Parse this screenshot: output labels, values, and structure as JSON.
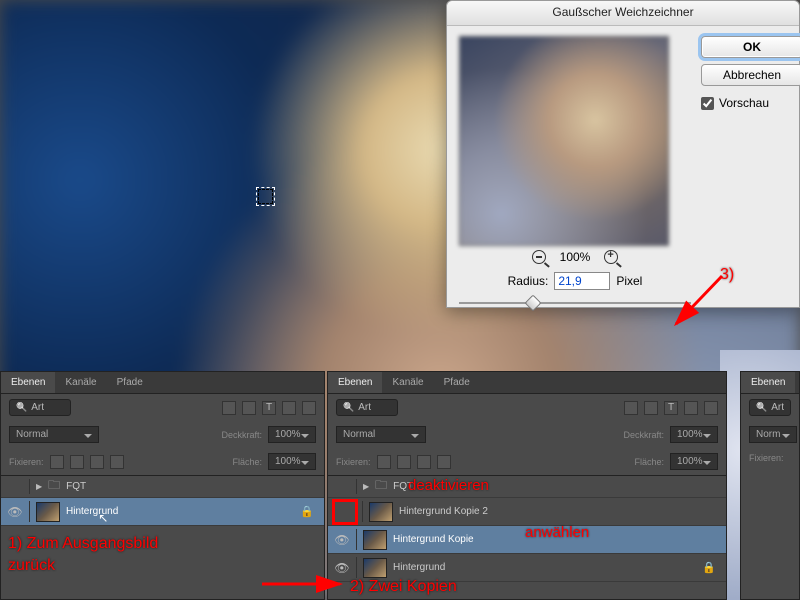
{
  "dialog": {
    "title": "Gaußscher Weichzeichner",
    "ok": "OK",
    "cancel": "Abbrechen",
    "preview_label": "Vorschau",
    "zoom": "100%",
    "radius_label": "Radius:",
    "radius_value": "21,9",
    "radius_unit": "Pixel"
  },
  "panel": {
    "tabs": {
      "layers": "Ebenen",
      "channels": "Kanäle",
      "paths": "Pfade"
    },
    "search_kind": "Art",
    "blend_mode": "Normal",
    "opacity_label": "Deckkraft:",
    "opacity_value": "100%",
    "lock_label": "Fixieren:",
    "fill_label": "Fläche:",
    "fill_value": "100%"
  },
  "p1_layers": {
    "group": "FQT",
    "bg": "Hintergrund"
  },
  "p2_layers": {
    "group": "FQT",
    "l1": "Hintergrund Kopie 2",
    "l2": "Hintergrund Kopie",
    "l3": "Hintergrund"
  },
  "annotations": {
    "a1": "1) Zum Ausgangsbild zurück",
    "a2": "2) Zwei Kopien",
    "a3": "3)",
    "deact": "deaktivieren",
    "select": "anwählen"
  }
}
